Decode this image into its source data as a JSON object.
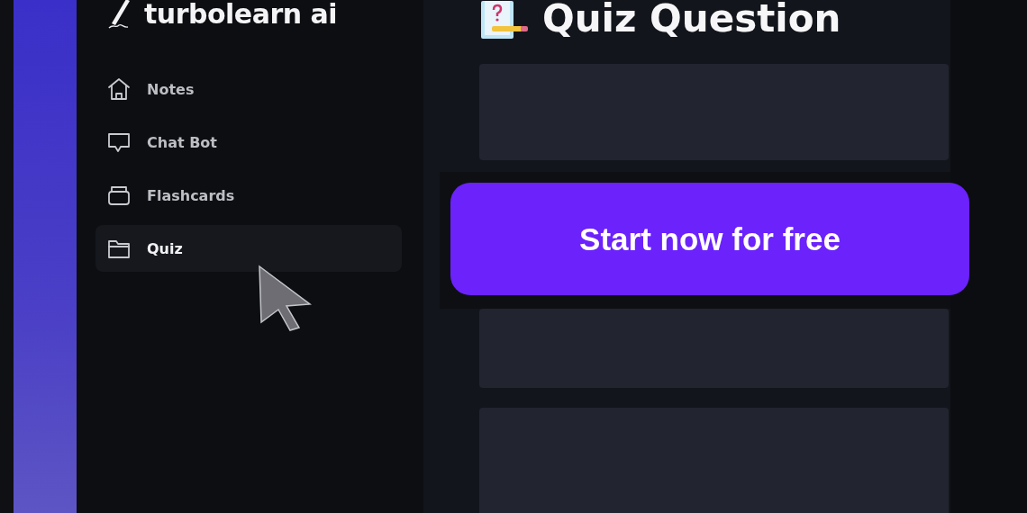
{
  "brand": {
    "name": "turbolearn ai"
  },
  "sidebar": {
    "items": [
      {
        "label": "Notes",
        "kind": "home",
        "selected": false
      },
      {
        "label": "Chat Bot",
        "kind": "chat",
        "selected": false
      },
      {
        "label": "Flashcards",
        "kind": "tray",
        "selected": false
      },
      {
        "label": "Quiz",
        "kind": "folder",
        "selected": true
      }
    ]
  },
  "main": {
    "title": "Quiz Question",
    "cta": "Start now for free",
    "cards": [
      {
        "kind": "placeholder"
      },
      {
        "kind": "placeholder"
      },
      {
        "kind": "placeholder"
      }
    ]
  }
}
